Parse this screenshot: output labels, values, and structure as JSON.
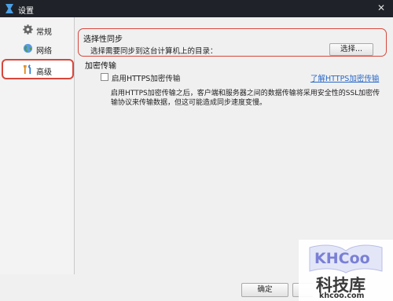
{
  "window": {
    "title": "设置",
    "close_glyph": "✕"
  },
  "sidebar": {
    "items": [
      {
        "label": "常规",
        "icon": "gear-icon"
      },
      {
        "label": "网络",
        "icon": "globe-icon"
      },
      {
        "label": "高级",
        "icon": "tools-icon",
        "selected": true
      }
    ]
  },
  "main": {
    "sync_group": {
      "title": "选择性同步",
      "description": "选择需要同步到这台计算机上的目录：",
      "choose_button": "选择..."
    },
    "encryption": {
      "title": "加密传输",
      "checkbox_label": "启用HTTPS加密传输",
      "checked": false,
      "learn_more_link": "了解HTTPS加密传输",
      "description": "启用HTTPS加密传输之后，客户端和服务器之间的数据传输将采用安全性的SSL加密传输协议来传输数据，但这可能造成同步速度变慢。"
    }
  },
  "footer": {
    "ok_button": "确定"
  },
  "watermark": {
    "logo": "KHCoo",
    "cn": "科技库",
    "url": "khcoo.com"
  },
  "colors": {
    "titlebar": "#1f2329",
    "highlight_red": "#d8473b",
    "link_blue": "#2a68c8",
    "accent_logo": "#7a7fd6"
  }
}
